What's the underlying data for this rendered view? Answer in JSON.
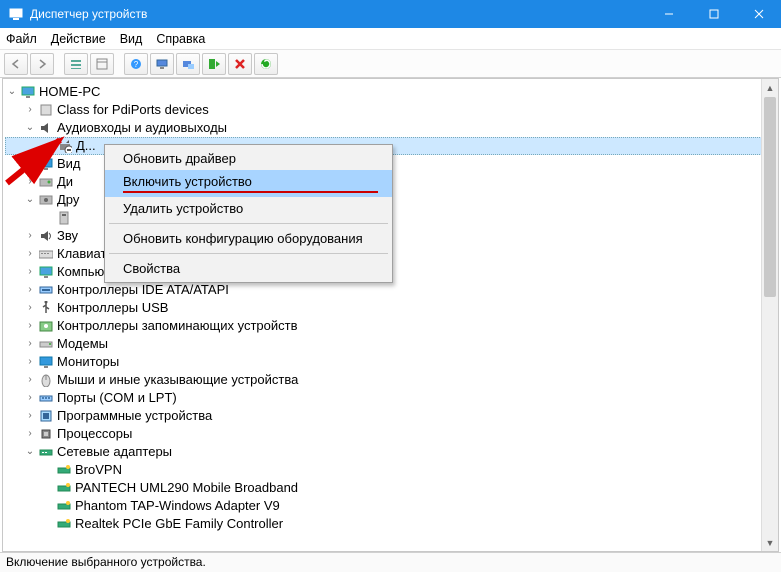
{
  "window": {
    "title": "Диспетчер устройств"
  },
  "menu": {
    "file": "Файл",
    "action": "Действие",
    "view": "Вид",
    "help": "Справка"
  },
  "tree": {
    "root": "HOME-PC",
    "items": [
      {
        "label": "Class for PdiPorts devices",
        "icon": "generic"
      },
      {
        "label": "Аудиовходы и аудиовыходы",
        "icon": "audio",
        "expanded": true,
        "children": [
          {
            "label": "Д...",
            "icon": "disabled-device",
            "selected": true
          }
        ]
      },
      {
        "label": "Вид",
        "icon": "display",
        "partial": true
      },
      {
        "label": "Ди",
        "icon": "disk",
        "partial": true
      },
      {
        "label": "Дру",
        "icon": "other",
        "expanded": true,
        "partial": true,
        "children": [
          {
            "label": "",
            "icon": "usb-device",
            "partial": true
          }
        ]
      },
      {
        "label": "Зву",
        "icon": "sound",
        "partial": true
      },
      {
        "label": "Клавиатуры",
        "icon": "keyboard",
        "partial": true
      },
      {
        "label": "Компьютер",
        "icon": "computer"
      },
      {
        "label": "Контроллеры IDE ATA/ATAPI",
        "icon": "ide"
      },
      {
        "label": "Контроллеры USB",
        "icon": "usb"
      },
      {
        "label": "Контроллеры запоминающих устройств",
        "icon": "storage"
      },
      {
        "label": "Модемы",
        "icon": "modem"
      },
      {
        "label": "Мониторы",
        "icon": "monitor"
      },
      {
        "label": "Мыши и иные указывающие устройства",
        "icon": "mouse"
      },
      {
        "label": "Порты (COM и LPT)",
        "icon": "port"
      },
      {
        "label": "Программные устройства",
        "icon": "software"
      },
      {
        "label": "Процессоры",
        "icon": "cpu"
      },
      {
        "label": "Сетевые адаптеры",
        "icon": "network",
        "expanded": true,
        "children": [
          {
            "label": "BroVPN",
            "icon": "net-adapter"
          },
          {
            "label": "PANTECH UML290 Mobile Broadband",
            "icon": "net-adapter"
          },
          {
            "label": "Phantom TAP-Windows Adapter V9",
            "icon": "net-adapter"
          },
          {
            "label": "Realtek PCIe GbE Family Controller",
            "icon": "net-adapter"
          }
        ]
      }
    ]
  },
  "context_menu": {
    "update_driver": "Обновить драйвер",
    "enable_device": "Включить устройство",
    "remove_device": "Удалить устройство",
    "scan_hardware": "Обновить конфигурацию оборудования",
    "properties": "Свойства"
  },
  "statusbar": "Включение выбранного устройства.",
  "toolbar_icons": [
    "back",
    "forward",
    "show-hidden",
    "details",
    "help",
    "computer",
    "scan",
    "enable",
    "delete",
    "refresh"
  ]
}
